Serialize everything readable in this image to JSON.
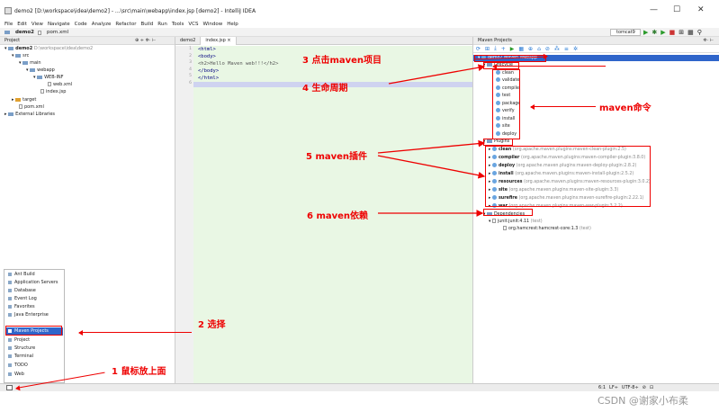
{
  "window": {
    "title": "demo2 [D:\\workspace\\idea\\demo2] - ...\\src\\main\\webapp\\index.jsp [demo2] - IntelliJ IDEA",
    "min": "—",
    "max": "☐",
    "close": "✕"
  },
  "menu": [
    "File",
    "Edit",
    "View",
    "Navigate",
    "Code",
    "Analyze",
    "Refactor",
    "Build",
    "Run",
    "Tools",
    "VCS",
    "Window",
    "Help"
  ],
  "breadcrumb": {
    "project": "demo2",
    "file": "pom.xml"
  },
  "run_config": "tomcat9",
  "project_panel": {
    "header": "Project",
    "rows": [
      {
        "label": "demo2",
        "extra": "D:\\workspace\\idea\\demo2"
      },
      {
        "label": "src"
      },
      {
        "label": "main"
      },
      {
        "label": "webapp"
      },
      {
        "label": "WEB-INF"
      },
      {
        "label": "web.xml"
      },
      {
        "label": "index.jsp"
      },
      {
        "label": "target"
      },
      {
        "label": "pom.xml"
      },
      {
        "label": "External Libraries"
      }
    ]
  },
  "editor": {
    "tabs": [
      "demo2",
      "index.jsp"
    ],
    "line_numbers": [
      "1",
      "2",
      "3",
      "4",
      "5",
      "6"
    ],
    "lines": [
      {
        "text": "<html>"
      },
      {
        "text": "<body>"
      },
      {
        "text": "<h2>Hello Maven web!!!</h2>"
      },
      {
        "text": "</body>"
      },
      {
        "text": "</html>"
      },
      {
        "text": ""
      }
    ]
  },
  "maven_panel": {
    "header": "Maven Projects",
    "root": "demo2 Maven Webapp",
    "lifecycle_label": "Lifecycle",
    "lifecycle": [
      "clean",
      "validate",
      "compile",
      "test",
      "package",
      "verify",
      "install",
      "site",
      "deploy"
    ],
    "plugins_label": "Plugins",
    "plugins": [
      {
        "name": "clean",
        "detail": "(org.apache.maven.plugins:maven-clean-plugin:2.5)"
      },
      {
        "name": "compiler",
        "detail": "(org.apache.maven.plugins:maven-compiler-plugin:3.8.0)"
      },
      {
        "name": "deploy",
        "detail": "(org.apache.maven.plugins:maven-deploy-plugin:2.8.2)"
      },
      {
        "name": "install",
        "detail": "(org.apache.maven.plugins:maven-install-plugin:2.5.2)"
      },
      {
        "name": "resources",
        "detail": "(org.apache.maven.plugins:maven-resources-plugin:3.0.2)"
      },
      {
        "name": "site",
        "detail": "(org.apache.maven.plugins:maven-site-plugin:3.3)"
      },
      {
        "name": "surefire",
        "detail": "(org.apache.maven.plugins:maven-surefire-plugin:2.22.1)"
      },
      {
        "name": "war",
        "detail": "(org.apache.maven.plugins:maven-war-plugin:3.2.2)"
      }
    ],
    "deps_label": "Dependencies",
    "deps": [
      {
        "name": "junit:junit:4.11",
        "scope": "(test)"
      },
      {
        "name": "org.hamcrest:hamcrest-core:1.3",
        "scope": "(test)"
      }
    ]
  },
  "tool_windows": [
    "Ant Build",
    "Application Servers",
    "Database",
    "Event Log",
    "Favorites",
    "Java Enterprise",
    "Maven Projects",
    "Project",
    "Structure",
    "Terminal",
    "TODO",
    "Web"
  ],
  "annotations": {
    "a1": "1 鼠标放上面",
    "a2": "2 选择",
    "a3": "3 点击maven项目",
    "a4": "4 生命周期",
    "a5": "5 maven插件",
    "a6": "6 maven依赖",
    "a7": "maven命令"
  },
  "status": {
    "position": "6:1",
    "line_sep": "LF÷",
    "encoding": "UTF-8÷"
  },
  "watermark": "CSDN @谢家小布柔",
  "colors": {
    "annotation": "#e00000",
    "selection": "#2f65ca",
    "editor_bg": "#e9f7e4"
  }
}
